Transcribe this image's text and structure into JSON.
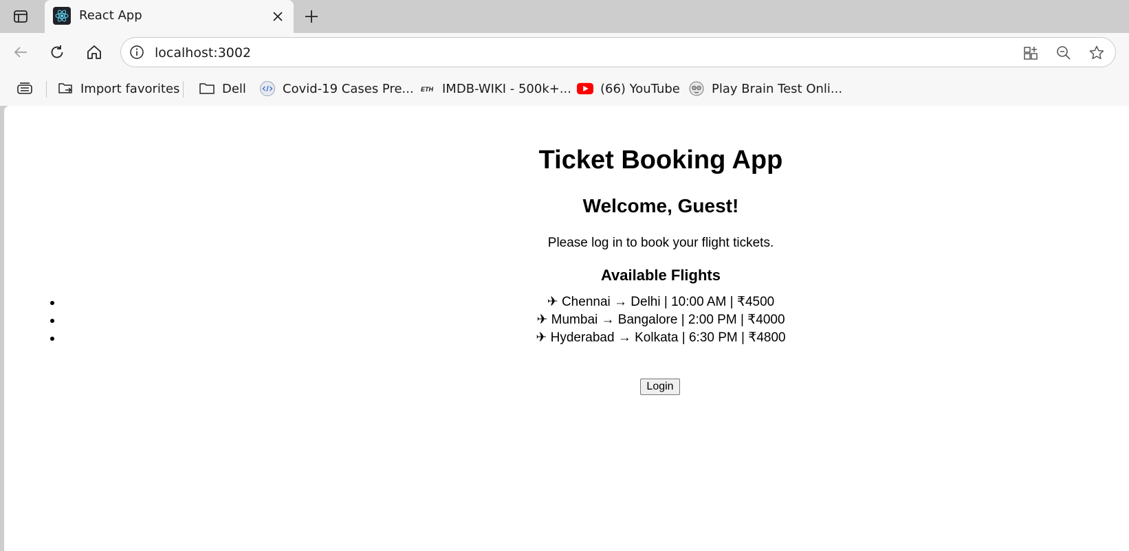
{
  "browser": {
    "tab": {
      "title": "React App",
      "favicon": "react-logo-icon"
    },
    "address_bar": {
      "url": "localhost:3002"
    },
    "favorites": [
      {
        "label": "Import favorites",
        "icon": "import-favorites-icon"
      },
      {
        "label": "Dell",
        "icon": "folder-icon"
      },
      {
        "label": "Covid-19 Cases Pre...",
        "icon": "code-globe-icon"
      },
      {
        "label": "IMDB-WIKI - 500k+...",
        "icon": "eth-logo-icon"
      },
      {
        "label": "(66) YouTube",
        "icon": "youtube-icon"
      },
      {
        "label": "Play Brain Test Onli...",
        "icon": "brain-test-icon"
      }
    ],
    "colors": {
      "chrome": "#cdcdcd",
      "toolbar": "#f7f7f7",
      "youtube_red": "#ff0000"
    }
  },
  "page": {
    "title": "Ticket Booking App",
    "welcome": "Welcome, Guest!",
    "prompt": "Please log in to book your flight tickets.",
    "flights_heading": "Available Flights",
    "flights": [
      "✈ Chennai → Delhi | 10:00 AM | ₹4500",
      "✈ Mumbai → Bangalore | 2:00 PM | ₹4000",
      "✈ Hyderabad → Kolkata | 6:30 PM | ₹4800"
    ],
    "login_label": "Login"
  }
}
